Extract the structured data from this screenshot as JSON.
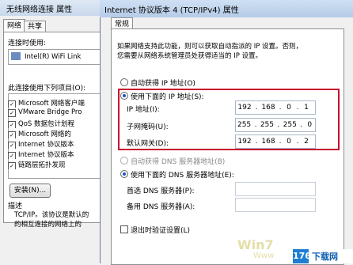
{
  "back_dialog": {
    "title": "无线网络连接 属性",
    "tabs": [
      "网络",
      "共享"
    ],
    "connect_using_label": "连接时使用:",
    "adapter": "Intel(R) WiFi Link",
    "items_label": "此连接使用下列项目(O):",
    "items": [
      {
        "label": "Microsoft 网络客户端",
        "checked": true
      },
      {
        "label": "VMware Bridge Pro",
        "checked": true
      },
      {
        "label": "QoS 数据包计划程",
        "checked": true
      },
      {
        "label": "Microsoft 网络的",
        "checked": true
      },
      {
        "label": "Internet 协议版本",
        "checked": true
      },
      {
        "label": "Internet 协议版本",
        "checked": true
      },
      {
        "label": "链路层拓扑发现",
        "checked": true
      }
    ],
    "install_button": "安装(N)...",
    "description_label": "描述",
    "description_text_1": "TCP/IP。该协议是默认的",
    "description_text_2": "的相互连接的网络上的"
  },
  "main_dialog": {
    "title": "Internet 协议版本 4 (TCP/IPv4) 属性",
    "tab": "常规",
    "intro_line1": "如果网络支持此功能，则可以获取自动指派的 IP 设置。否则，",
    "intro_line2": "您需要从网络系统管理员处获得适当的 IP 设置。",
    "auto_ip_label": "自动获得 IP 地址(O)",
    "manual_ip_label": "使用下面的 IP 地址(S):",
    "ip_label": "IP 地址(I):",
    "ip_value": [
      "192",
      "168",
      "0",
      "1"
    ],
    "subnet_label": "子网掩码(U):",
    "subnet_value": [
      "255",
      "255",
      "255",
      "0"
    ],
    "gateway_label": "默认网关(D):",
    "gateway_value": [
      "192",
      "168",
      "0",
      "2"
    ],
    "auto_dns_label": "自动获得 DNS 服务器地址(B)",
    "manual_dns_label": "使用下面的 DNS 服务器地址(E):",
    "preferred_dns_label": "首选 DNS 服务器(P):",
    "alternate_dns_label": "备用 DNS 服务器(A):",
    "validate_label": "退出时验证设置(L)"
  },
  "watermark": {
    "logo_badge": "176",
    "logo_text": "下载网"
  },
  "colors": {
    "highlight_box": "#c8102e",
    "radio_dot": "#1a56c4"
  }
}
